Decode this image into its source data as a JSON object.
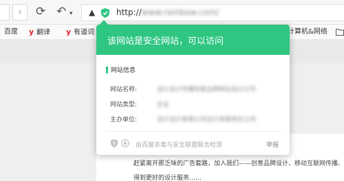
{
  "toolbar": {
    "forward_glyph": "›",
    "refresh_glyph": "⟳",
    "undo_glyph": "↶",
    "undo_menu_glyph": "▾"
  },
  "address_bar": {
    "accel_glyph": "▲",
    "shield_glyph": "✓",
    "url_prefix": "http://",
    "url_rest": "www.rainbow.com/"
  },
  "bookmarks": [
    {
      "label": "百度"
    },
    {
      "label": "翻译",
      "icon": "y"
    },
    {
      "label": "有道词",
      "icon": "y"
    },
    {
      "label": "计算机&网络"
    }
  ],
  "popup": {
    "title": "该网站是安全网站，可以访问",
    "section_title": "网站信息",
    "rows": [
      {
        "label": "网站名称:",
        "value": "设计设计传播创意品牌网站设计公司"
      },
      {
        "label": "网站类型:",
        "value": "企业"
      },
      {
        "label": "主办单位:",
        "value": "设计设计有限公司设计有限责任公司"
      }
    ],
    "footer_text": "由百度杀毒与安全联盟联合检测",
    "report_label": "举报"
  },
  "page": {
    "line1": "赶紧离开那乏味的广告套路，加入我们——创意品牌设计、移动互联网传播、随",
    "line2": "得到更好的设计服务……"
  },
  "colors": {
    "safe_green": "#2fc682",
    "bookmark_y": "#e0262c"
  }
}
